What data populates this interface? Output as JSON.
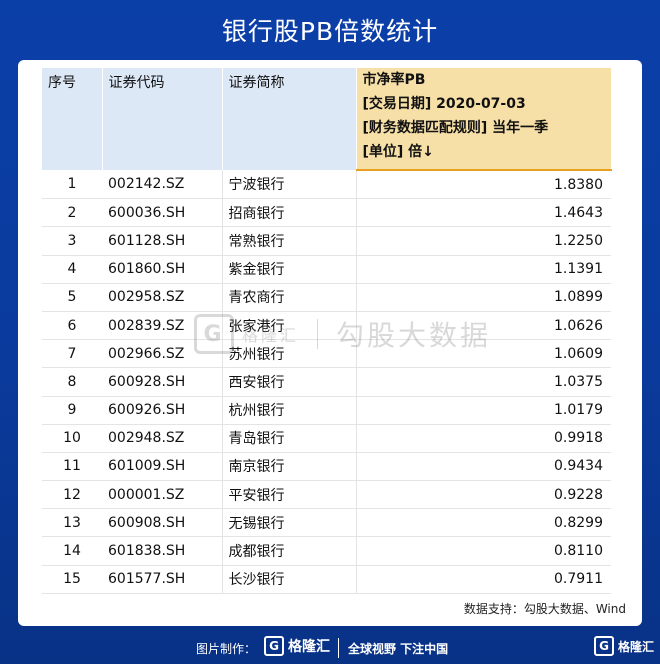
{
  "title": "银行股PB倍数统计",
  "header": {
    "index": "序号",
    "code": "证券代码",
    "name": "证券简称",
    "metric_lines": [
      "市净率PB",
      "[交易日期] 2020-07-03",
      "[财务数据匹配规则] 当年一季",
      "[单位] 倍↓"
    ]
  },
  "rows": [
    {
      "index": "1",
      "code": "002142.SZ",
      "name": "宁波银行",
      "value": "1.8380"
    },
    {
      "index": "2",
      "code": "600036.SH",
      "name": "招商银行",
      "value": "1.4643"
    },
    {
      "index": "3",
      "code": "601128.SH",
      "name": "常熟银行",
      "value": "1.2250"
    },
    {
      "index": "4",
      "code": "601860.SH",
      "name": "紫金银行",
      "value": "1.1391"
    },
    {
      "index": "5",
      "code": "002958.SZ",
      "name": "青农商行",
      "value": "1.0899"
    },
    {
      "index": "6",
      "code": "002839.SZ",
      "name": "张家港行",
      "value": "1.0626"
    },
    {
      "index": "7",
      "code": "002966.SZ",
      "name": "苏州银行",
      "value": "1.0609"
    },
    {
      "index": "8",
      "code": "600928.SH",
      "name": "西安银行",
      "value": "1.0375"
    },
    {
      "index": "9",
      "code": "600926.SH",
      "name": "杭州银行",
      "value": "1.0179"
    },
    {
      "index": "10",
      "code": "002948.SZ",
      "name": "青岛银行",
      "value": "0.9918"
    },
    {
      "index": "11",
      "code": "601009.SH",
      "name": "南京银行",
      "value": "0.9434"
    },
    {
      "index": "12",
      "code": "000001.SZ",
      "name": "平安银行",
      "value": "0.9228"
    },
    {
      "index": "13",
      "code": "600908.SH",
      "name": "无锡银行",
      "value": "0.8299"
    },
    {
      "index": "14",
      "code": "601838.SH",
      "name": "成都银行",
      "value": "0.8110"
    },
    {
      "index": "15",
      "code": "601577.SH",
      "name": "长沙银行",
      "value": "0.7911"
    }
  ],
  "watermark": {
    "logo": "G",
    "name": "格隆汇",
    "text": "勾股大数据"
  },
  "source": "数据支持：勾股大数据、Wind",
  "footer": {
    "made_by": "图片制作：",
    "logo_letter": "G",
    "brand": "格隆汇",
    "slogan": "全球视野 下注中国",
    "right_logo_letter": "G",
    "right_brand": "格隆汇"
  },
  "colors": {
    "background": "#0a3a9c",
    "header_fill": "#dde8f7",
    "metric_fill": "#f7e0a8",
    "metric_border": "#e8a020"
  }
}
